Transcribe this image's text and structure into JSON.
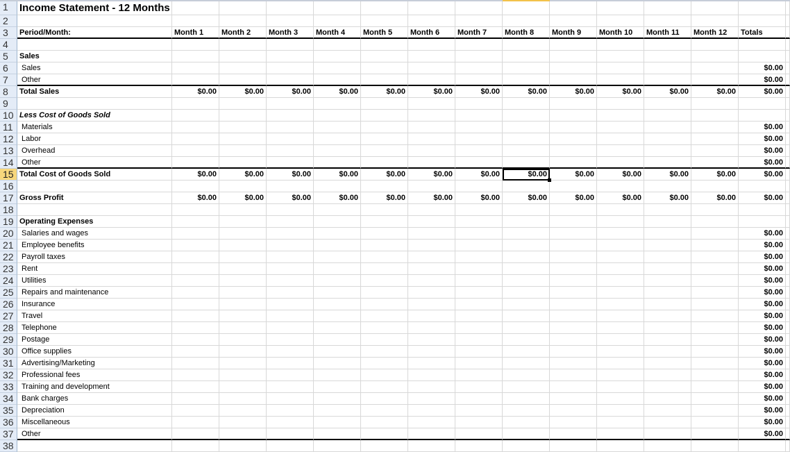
{
  "sheet": {
    "title": "Income Statement - 12 Months",
    "period_label": "Period/Month:",
    "columns": [
      "Month 1",
      "Month 2",
      "Month 3",
      "Month 4",
      "Month 5",
      "Month 6",
      "Month 7",
      "Month 8",
      "Month 9",
      "Month 10",
      "Month 11",
      "Month 12",
      "Totals"
    ],
    "selected_cell": "Month 8 / Total Cost of Goods Sold",
    "zero": "$0.00",
    "rows": [
      {
        "n": "1",
        "label": ""
      },
      {
        "n": "2",
        "label": ""
      },
      {
        "n": "3",
        "label": ""
      },
      {
        "n": "4",
        "label": ""
      },
      {
        "n": "5",
        "label": "Sales"
      },
      {
        "n": "6",
        "label": "Sales"
      },
      {
        "n": "7",
        "label": "Other"
      },
      {
        "n": "8",
        "label": "Total Sales"
      },
      {
        "n": "9",
        "label": ""
      },
      {
        "n": "10",
        "label": "Less Cost of Goods Sold"
      },
      {
        "n": "11",
        "label": "Materials"
      },
      {
        "n": "12",
        "label": "Labor"
      },
      {
        "n": "13",
        "label": "Overhead"
      },
      {
        "n": "14",
        "label": "Other"
      },
      {
        "n": "15",
        "label": "Total Cost of Goods Sold"
      },
      {
        "n": "16",
        "label": ""
      },
      {
        "n": "17",
        "label": "Gross Profit"
      },
      {
        "n": "18",
        "label": ""
      },
      {
        "n": "19",
        "label": "Operating Expenses"
      },
      {
        "n": "20",
        "label": "Salaries and wages"
      },
      {
        "n": "21",
        "label": "Employee benefits"
      },
      {
        "n": "22",
        "label": "Payroll taxes"
      },
      {
        "n": "23",
        "label": "Rent"
      },
      {
        "n": "24",
        "label": "Utilities"
      },
      {
        "n": "25",
        "label": "Repairs and maintenance"
      },
      {
        "n": "26",
        "label": "Insurance"
      },
      {
        "n": "27",
        "label": "Travel"
      },
      {
        "n": "28",
        "label": "Telephone"
      },
      {
        "n": "29",
        "label": "Postage"
      },
      {
        "n": "30",
        "label": "Office supplies"
      },
      {
        "n": "31",
        "label": "Advertising/Marketing"
      },
      {
        "n": "32",
        "label": "Professional fees"
      },
      {
        "n": "33",
        "label": "Training and development"
      },
      {
        "n": "34",
        "label": "Bank charges"
      },
      {
        "n": "35",
        "label": "Depreciation"
      },
      {
        "n": "36",
        "label": "Miscellaneous"
      },
      {
        "n": "37",
        "label": "Other"
      },
      {
        "n": "38",
        "label": ""
      }
    ]
  }
}
